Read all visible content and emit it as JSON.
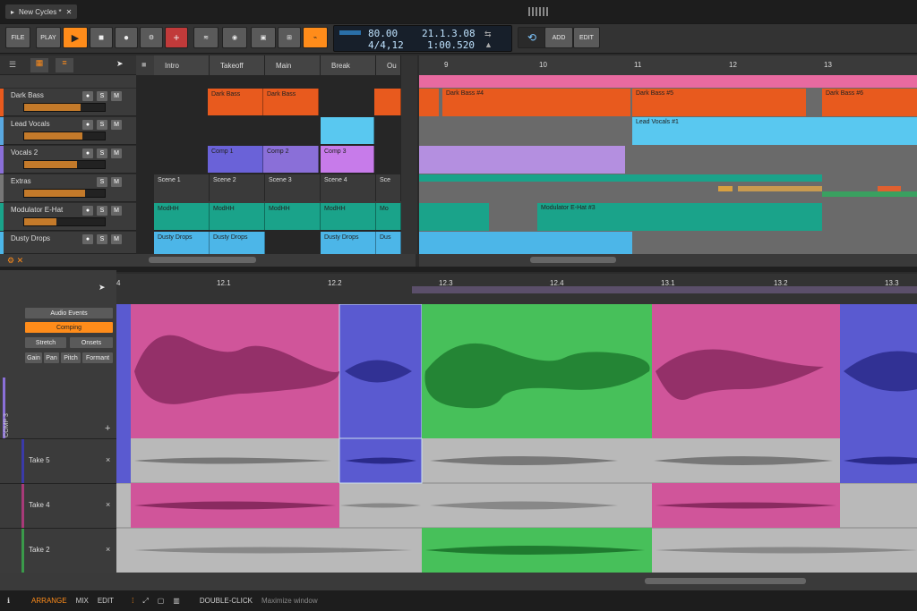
{
  "project_tab": {
    "title": "New Cycles *"
  },
  "toolbar": {
    "file": "FILE",
    "play_label": "PLAY",
    "add": "ADD",
    "edit": "EDIT"
  },
  "transport": {
    "tempo": "80.00",
    "time_sig": "4/4,12",
    "position": "21.1.3.08",
    "time": "1:00.520"
  },
  "tracks": [
    {
      "name": "Dark Bass",
      "color": "#e85a1e"
    },
    {
      "name": "Lead Vocals",
      "color": "#59a8e0"
    },
    {
      "name": "Vocals 2",
      "color": "#8a6fd8"
    },
    {
      "name": "Extras",
      "color": "#3a3a3a"
    },
    {
      "name": "Modulator E-Hat",
      "color": "#1aa38a"
    },
    {
      "name": "Dusty Drops",
      "color": "#4cb6e8"
    }
  ],
  "scenes": [
    "Intro",
    "Takeoff",
    "Main",
    "Break",
    "Ou"
  ],
  "launcher_clips": {
    "dark_bass": [
      "Dark Bass",
      "Dark Bass"
    ],
    "lead_vocals": [
      ""
    ],
    "vocals2": [
      "Comp 1",
      "Comp 2",
      "Comp 3"
    ],
    "extras": [
      "Scene 1",
      "Scene 2",
      "Scene 3",
      "Scene 4",
      "Sce"
    ],
    "modhh": [
      "ModHH",
      "ModHH",
      "ModHH",
      "ModHH",
      "Mo"
    ],
    "dusty": [
      "Dusty Drops",
      "Dusty Drops",
      "",
      "Dusty Drops",
      "Dus"
    ]
  },
  "arranger_ruler": [
    "9",
    "10",
    "11",
    "12",
    "13"
  ],
  "arranger_clips": {
    "dark_bass": [
      "Dark Bass #4",
      "Dark Bass #5",
      "Dark Bass #6"
    ],
    "lead_vocals": "Lead Vocals #1",
    "modulator": "Modulator E-Hat #3"
  },
  "editor": {
    "buttons": {
      "audio_events": "Audio Events",
      "comping": "Comping",
      "stretch": "Stretch",
      "onsets": "Onsets",
      "gain": "Gain",
      "pan": "Pan",
      "pitch": "Pitch",
      "formant": "Formant"
    },
    "ruler": [
      "4",
      "12.1",
      "12.2",
      "12.3",
      "12.4",
      "13.1",
      "13.2",
      "13.3"
    ],
    "comp_label": "COMP 3",
    "takes": [
      "Take 5",
      "Take 4",
      "Take 2"
    ],
    "plus": "+",
    "close": "×"
  },
  "statusbar": {
    "arrange": "ARRANGE",
    "mix": "MIX",
    "edit": "EDIT",
    "hint_key": "DOUBLE-CLICK",
    "hint": "Maximize window"
  },
  "colors": {
    "accent": "#ff8c1a",
    "take_blue": "#5a5ad0",
    "take_pink": "#d0559a",
    "take_green": "#47c05a"
  }
}
